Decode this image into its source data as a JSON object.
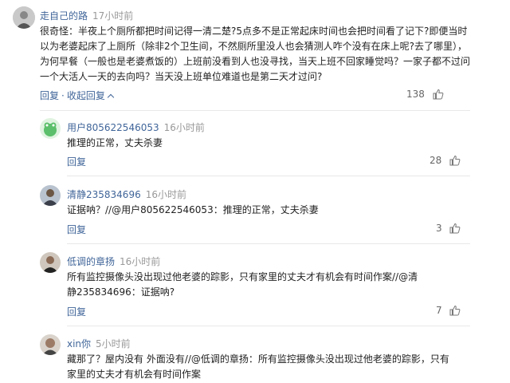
{
  "main_comment": {
    "author": "走自己的路",
    "time": "17小时前",
    "text": "很奇怪：半夜上个厕所都把时间记得一清二楚?5点多不是正常起床时间也会把时间看了记下?即便当时以为老婆起床了上厕所（除非2个卫生间，不然厕所里没人也会猜测人咋个没有在床上呢?去了哪里），为何早餐（一般也是老婆煮饭的）上班前没看到人也没寻找，当天上班不回家睡觉吗？一家子都不过问一个大活人一天的去向吗？当天没上班单位难道也是第二天才过问?",
    "reply_label": "回复",
    "collapse_label": "收起回复",
    "likes": "138"
  },
  "replies": [
    {
      "author": "用户805622546053",
      "time": "16小时前",
      "text": "推理的正常，丈夫杀妻",
      "reply_label": "回复",
      "likes": "28"
    },
    {
      "author": "清静235834696",
      "time": "16小时前",
      "text": "证据呐？//@用户805622546053：推理的正常，丈夫杀妻",
      "reply_label": "回复",
      "likes": "3"
    },
    {
      "author": "低调的章扬",
      "time": "16小时前",
      "text": "所有监控摄像头没出现过他老婆的踪影，只有家里的丈夫才有机会有时间作案//@清静235834696：证据呐?",
      "reply_label": "回复",
      "likes": "7"
    },
    {
      "author": "xin你",
      "time": "5小时前",
      "text": "藏那了？屋内没有 外面没有//@低调的章扬：所有监控摄像头没出现过他老婆的踪影，只有家里的丈夫才有机会有时间作案"
    }
  ]
}
